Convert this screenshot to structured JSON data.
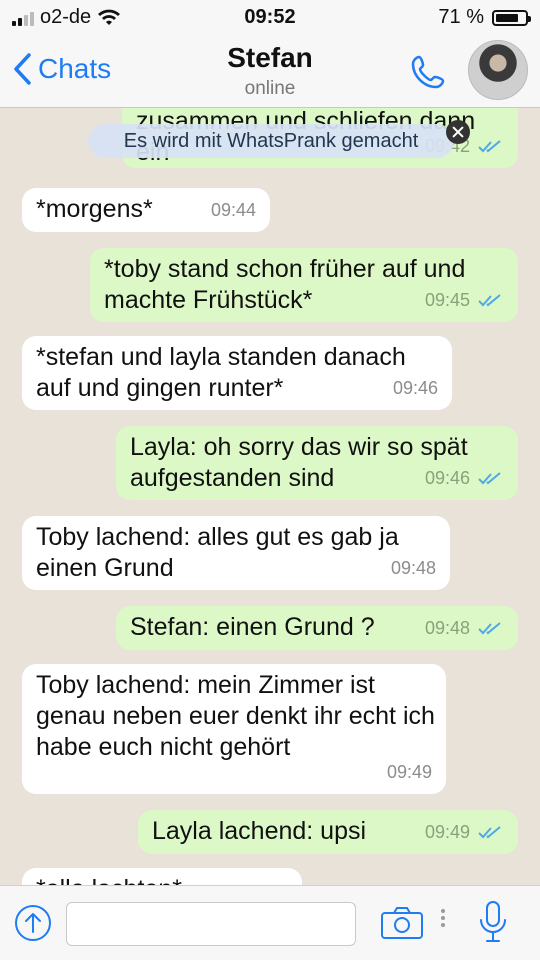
{
  "status": {
    "carrier": "o2-de",
    "time": "09:52",
    "battery": "71 %"
  },
  "nav": {
    "back_label": "Chats",
    "name": "Stefan",
    "status": "online"
  },
  "messages": [
    {
      "dir": "out",
      "text": "zusammen und schliefen dann ein",
      "time": "09:42"
    },
    {
      "dir": "in",
      "text": "*morgens*",
      "time": "09:44"
    },
    {
      "dir": "out",
      "text": "*toby stand schon früher auf und machte Frühstück*",
      "time": "09:45"
    },
    {
      "dir": "in",
      "text": "*stefan und layla standen danach auf und gingen runter*",
      "time": "09:46"
    },
    {
      "dir": "out",
      "text": "Layla: oh sorry das wir so spät aufgestanden sind",
      "time": "09:46"
    },
    {
      "dir": "in",
      "text": "Toby lachend: alles gut es gab ja einen Grund",
      "time": "09:48"
    },
    {
      "dir": "out",
      "text": "Stefan: einen Grund ?",
      "time": "09:48"
    },
    {
      "dir": "in",
      "text": "Toby lachend: mein Zimmer ist genau neben euer denkt ihr echt ich habe euch nicht gehört",
      "time": "09:49"
    },
    {
      "dir": "out",
      "text": "Layla lachend: upsi",
      "time": "09:49"
    },
    {
      "dir": "in",
      "text": "*alle lachten*",
      "time": ""
    }
  ],
  "banner": {
    "text": "Es wird mit WhatsPrank gemacht"
  },
  "colors": {
    "accent": "#1f7cf2",
    "outgoing": "#dcf8c6",
    "incoming": "#ffffff",
    "read_ticks": "#4fa8e8"
  }
}
